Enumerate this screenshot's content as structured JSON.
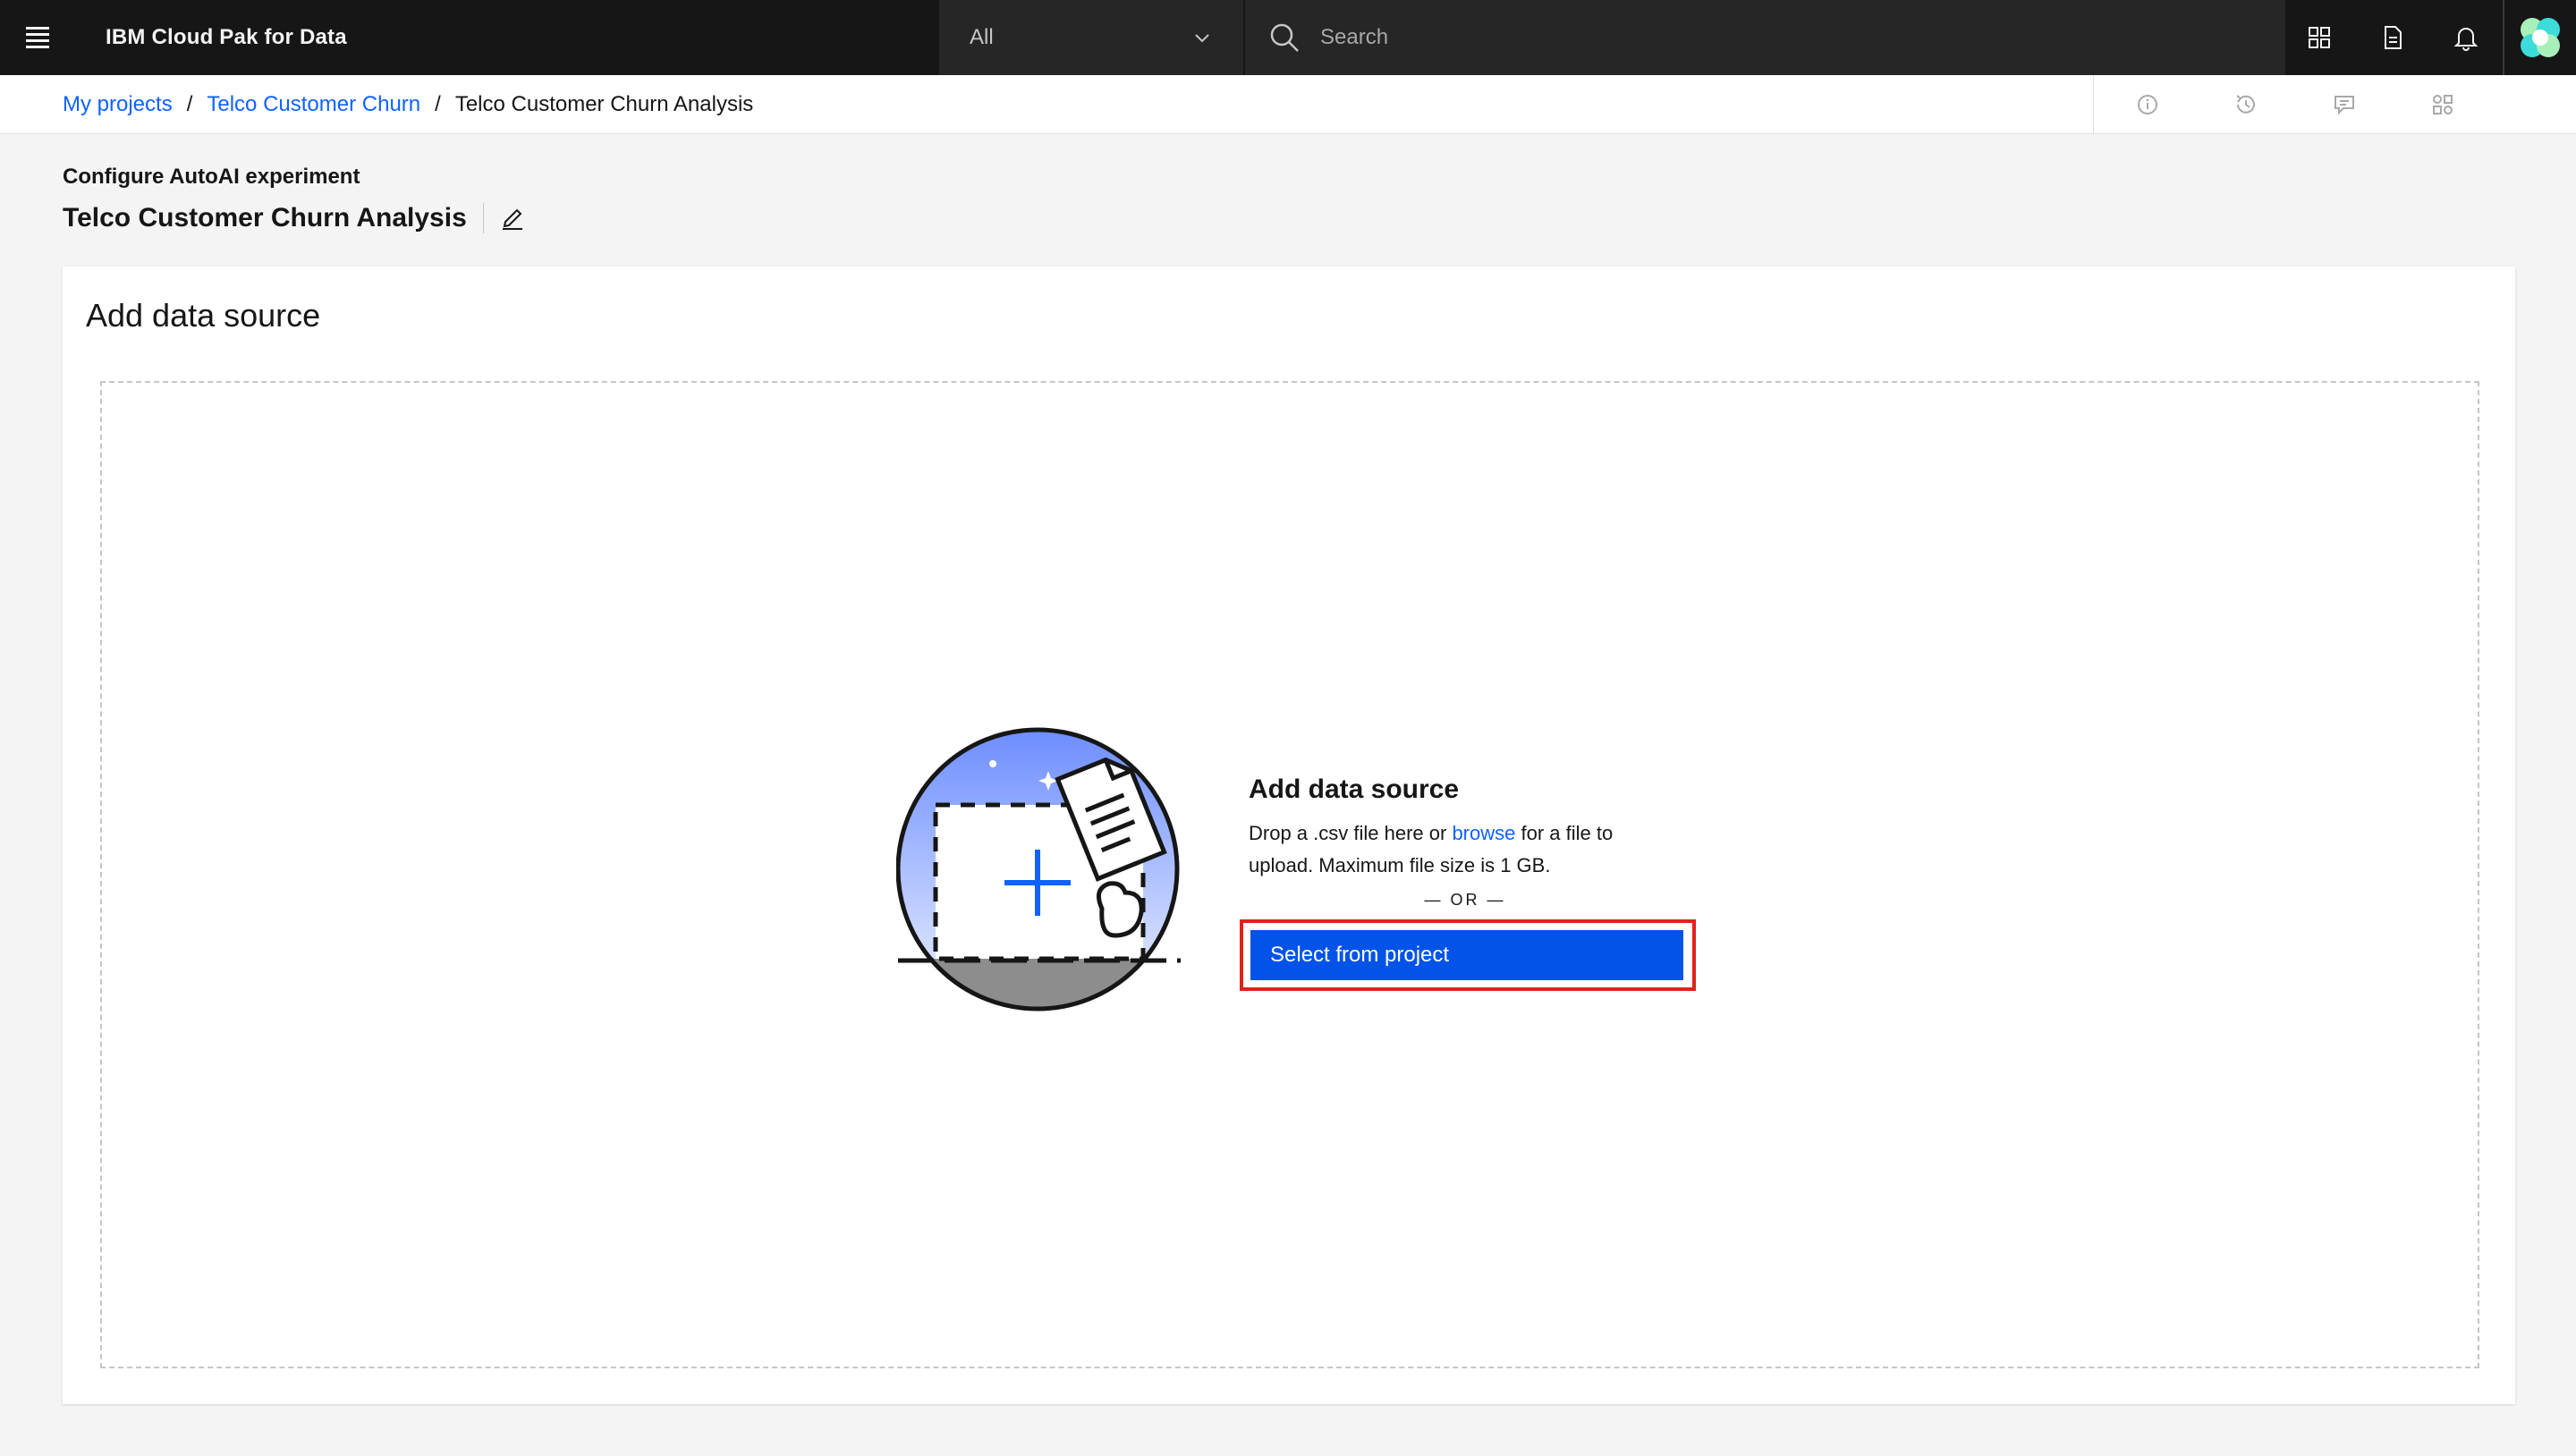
{
  "header": {
    "brand": "IBM Cloud Pak for Data",
    "scope_value": "All",
    "search_placeholder": "Search"
  },
  "breadcrumb": {
    "items": [
      "My projects",
      "Telco Customer Churn"
    ],
    "current": "Telco Customer Churn Analysis",
    "separator": "/"
  },
  "page": {
    "subtitle": "Configure AutoAI experiment",
    "title": "Telco Customer Churn Analysis"
  },
  "card": {
    "title": "Add data source",
    "dropzone": {
      "heading": "Add data source",
      "desc_before": "Drop a .csv file here or ",
      "browse_link": "browse",
      "desc_after": " for a file to upload. Maximum file size is 1 GB.",
      "or_text": "— OR —",
      "select_button": "Select from project"
    }
  },
  "colors": {
    "header_bg": "#161616",
    "accent": "#0f62fe",
    "button": "#0353e9",
    "highlight": "#e0231a"
  }
}
